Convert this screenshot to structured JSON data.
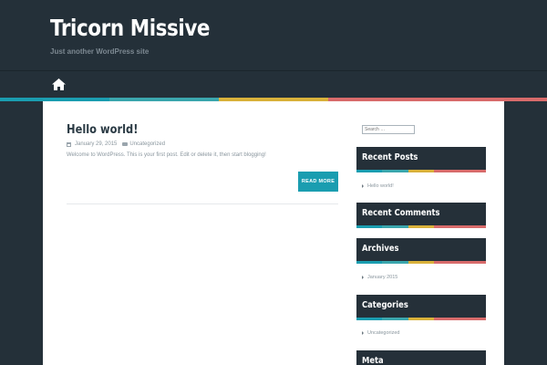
{
  "site": {
    "title": "Tricorn Missive",
    "description": "Just another WordPress site"
  },
  "nav": {
    "home_icon": "home-icon"
  },
  "stripe_colors": [
    "#1a9db0",
    "#3aa6ad",
    "#d9b13a",
    "#d86b6b"
  ],
  "post": {
    "title": "Hello world!",
    "date": "January 29, 2015",
    "category": "Uncategorized",
    "excerpt": "Welcome to WordPress. This is your first post. Edit or delete it, then start blogging!",
    "read_more_label": "READ MORE"
  },
  "sidebar": {
    "search_placeholder": "Search …",
    "widgets": [
      {
        "title": "Recent Posts",
        "items": [
          "Hello world!"
        ]
      },
      {
        "title": "Recent Comments",
        "items": []
      },
      {
        "title": "Archives",
        "items": [
          "January 2015"
        ]
      },
      {
        "title": "Categories",
        "items": [
          "Uncategorized"
        ]
      },
      {
        "title": "Meta",
        "items": []
      }
    ]
  }
}
